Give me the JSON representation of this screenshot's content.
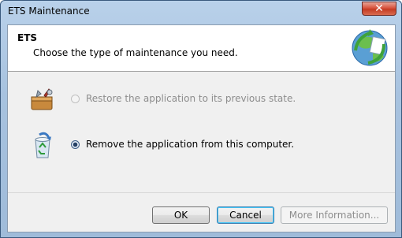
{
  "window": {
    "title": "ETS Maintenance",
    "close_glyph": "✕"
  },
  "header": {
    "app_name": "ETS",
    "subtitle": "Choose the type of maintenance you need.",
    "logo_icon": "setup-globe-icon"
  },
  "options": [
    {
      "label": "Restore the application to its previous state.",
      "icon": "toolbox-icon",
      "enabled": false,
      "selected": false
    },
    {
      "label": "Remove the application from this computer.",
      "icon": "recycle-bin-icon",
      "enabled": true,
      "selected": true
    }
  ],
  "buttons": {
    "ok": "OK",
    "cancel": "Cancel",
    "more_info": "More Information..."
  }
}
